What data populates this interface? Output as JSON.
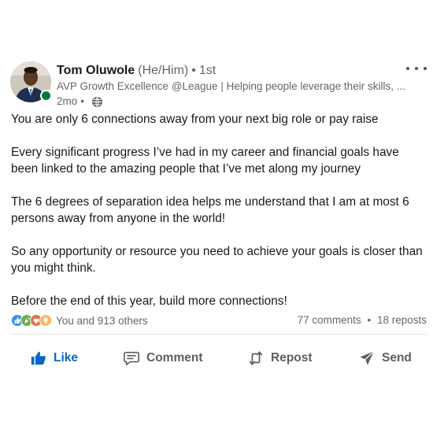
{
  "author": {
    "name": "Tom Oluwole",
    "pronouns": "(He/Him)",
    "separator": "•",
    "degree": "1st",
    "headline": "AVP Growth Excellence @League | Helping people leverage their skills, ...",
    "time": "2mo",
    "time_separator": "•"
  },
  "post": {
    "paragraphs": [
      "You are only 6 connections away from your next big role or pay raise",
      "Every significant progress I’ve had in my career and financial goals have been linked to the amazing people that I’ve met along my journey",
      "The 6 degrees of separation idea helps me understand that I am at most 6 persons away from anyone in the world!",
      "So any opportunity or resource you need to achieve your goals  is closer than you might think.",
      "Before the end of this year, build more connections!"
    ]
  },
  "social": {
    "reactions_label": "You and 913 others",
    "comments": "77 comments",
    "separator": "•",
    "reposts": "18 reposts"
  },
  "actions": {
    "like": "Like",
    "comment": "Comment",
    "repost": "Repost",
    "send": "Send"
  },
  "colors": {
    "like_blue": "#0a66c2",
    "presence_green": "#057642",
    "celebrate": "#6dae4f",
    "love": "#df704d",
    "insightful": "#f5bb5c"
  }
}
